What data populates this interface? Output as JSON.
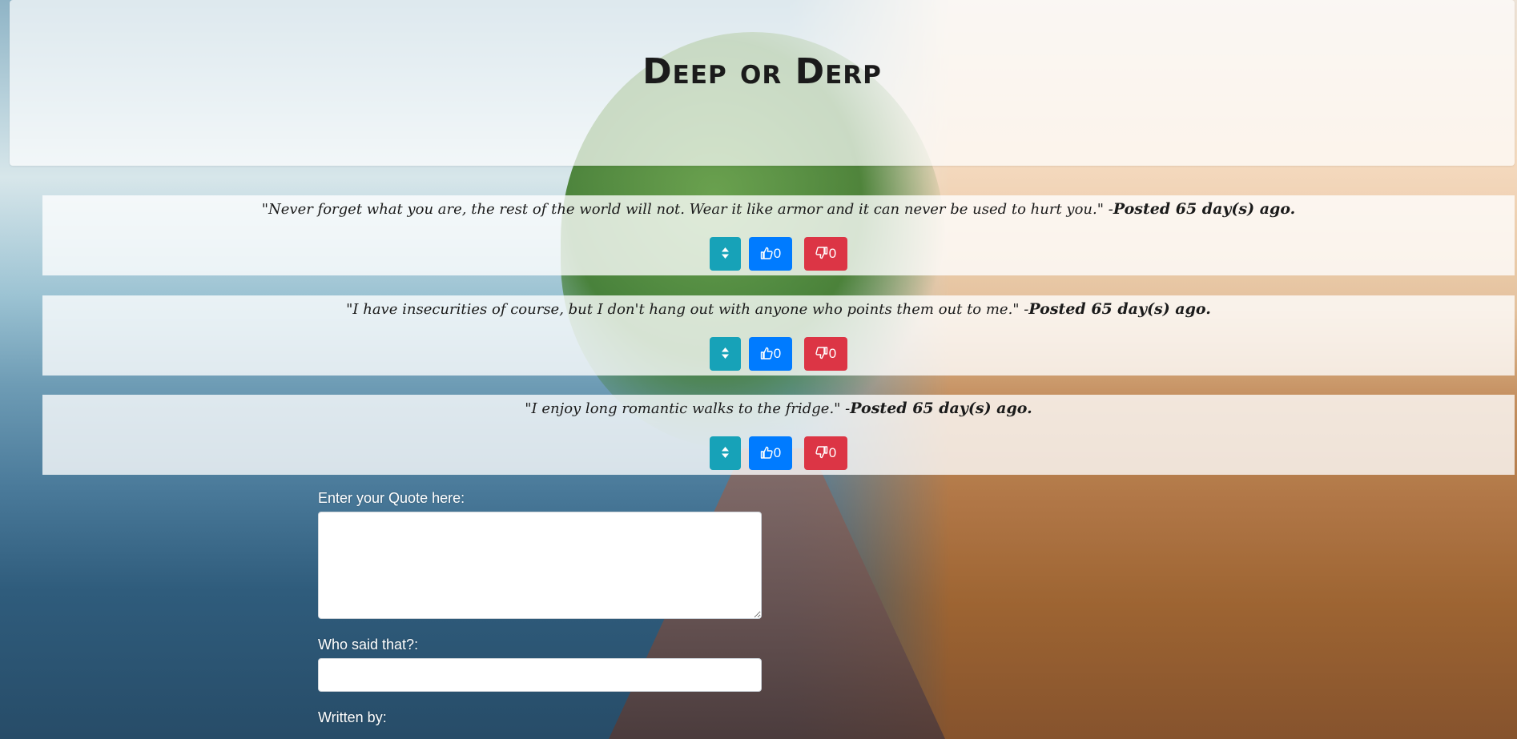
{
  "header": {
    "title": "Deep or Derp"
  },
  "quotes": [
    {
      "text": "\"Never forget what you are, the rest of the world will not. Wear it like armor and it can never be used to hurt you.\" -",
      "posted": "Posted 65 day(s) ago.",
      "upvotes": "0",
      "downvotes": "0"
    },
    {
      "text": "\"I have insecurities of course, but I don't hang out with anyone who points them out to me.\" -",
      "posted": "Posted 65 day(s) ago.",
      "upvotes": "0",
      "downvotes": "0"
    },
    {
      "text": "\"I enjoy long romantic walks to the fridge.\" -",
      "posted": "Posted 65 day(s) ago.",
      "upvotes": "0",
      "downvotes": "0"
    }
  ],
  "form": {
    "quote_label": "Enter your Quote here:",
    "quote_value": "",
    "author_label": "Who said that?:",
    "author_value": "",
    "written_by_label": "Written by:"
  },
  "icons": {
    "sort": "sort-icon",
    "upvote": "thumbs-up-icon",
    "downvote": "thumbs-down-icon"
  },
  "colors": {
    "sort_button": "#17a2b8",
    "upvote_button": "#007bff",
    "downvote_button": "#dc3545"
  }
}
